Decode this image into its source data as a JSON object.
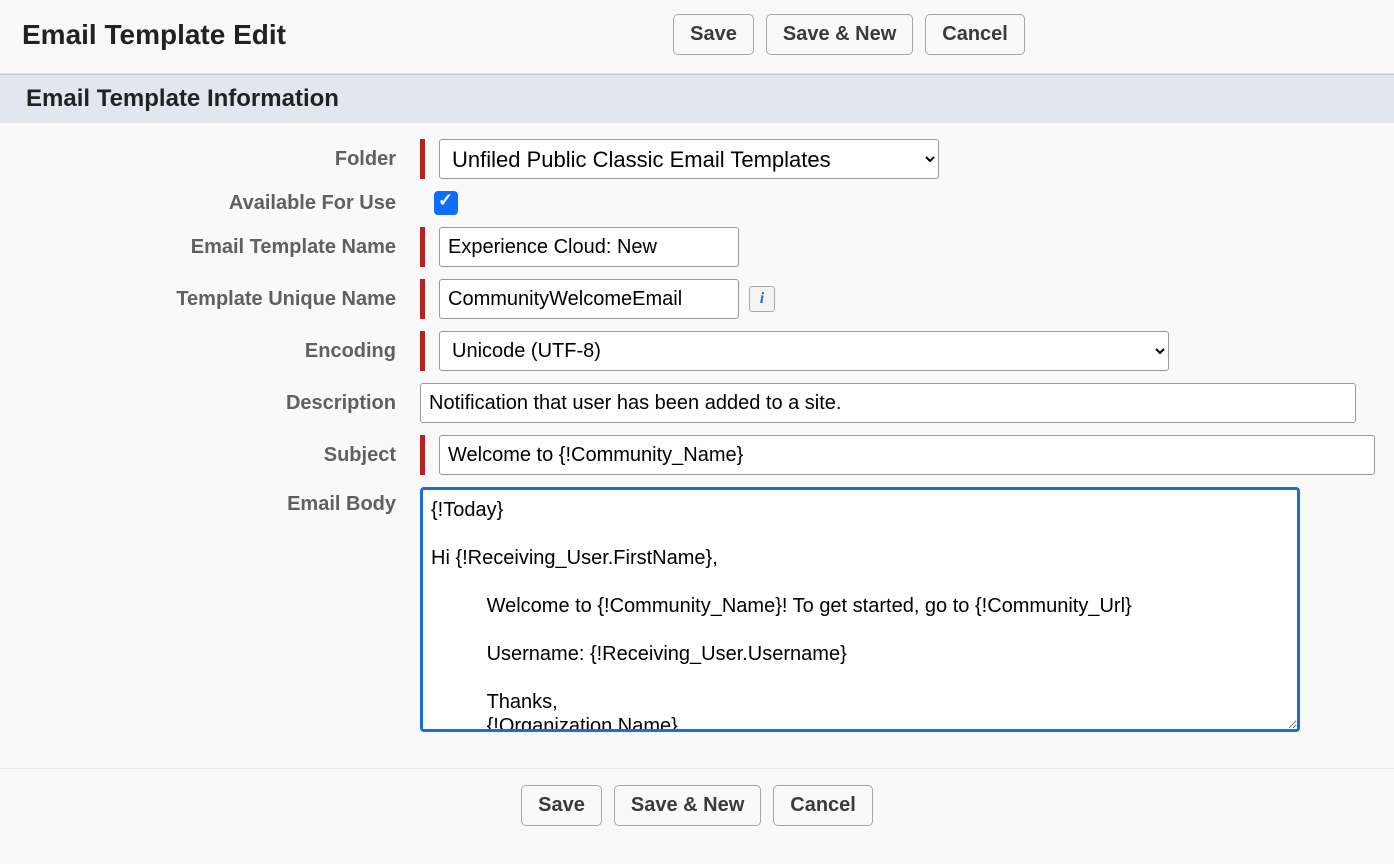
{
  "page": {
    "title": "Email Template Edit"
  },
  "buttons": {
    "save": "Save",
    "save_new": "Save & New",
    "cancel": "Cancel"
  },
  "section": {
    "header": "Email Template Information"
  },
  "labels": {
    "folder": "Folder",
    "available": "Available For Use",
    "name": "Email Template Name",
    "unique": "Template Unique Name",
    "encoding": "Encoding",
    "description": "Description",
    "subject": "Subject",
    "body": "Email Body"
  },
  "fields": {
    "folder_value": "Unfiled Public Classic Email Templates",
    "available_checked": true,
    "name_value": "Experience Cloud: New",
    "unique_value": "CommunityWelcomeEmail",
    "encoding_value": "Unicode (UTF-8)",
    "description_value": "Notification that user has been added to a site.",
    "subject_value": "Welcome to {!Community_Name}",
    "body_value": "{!Today}\n\nHi {!Receiving_User.FirstName},\n\n          Welcome to {!Community_Name}! To get started, go to {!Community_Url}\n\n          Username: {!Receiving_User.Username}\n\n          Thanks,\n          {!Organization.Name}"
  },
  "icons": {
    "info": "i"
  }
}
